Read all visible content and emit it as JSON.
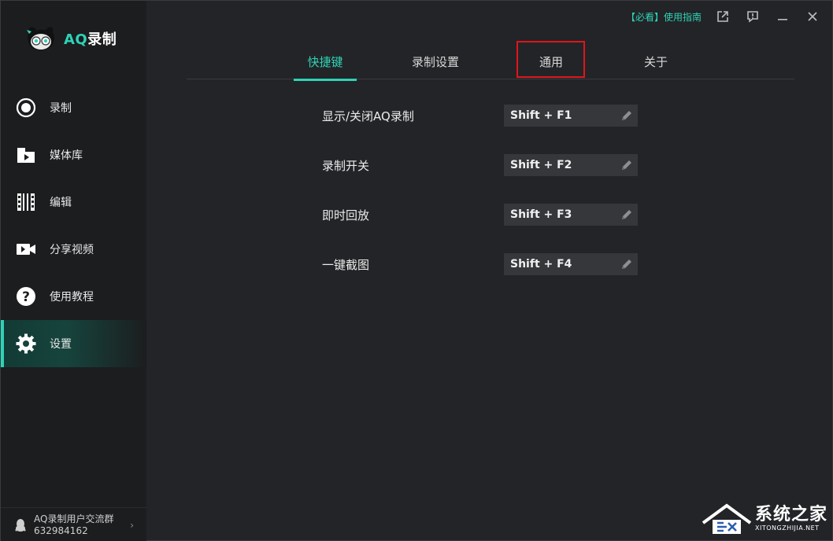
{
  "app": {
    "name_prefix": "AQ",
    "name_suffix": "录制"
  },
  "titlebar": {
    "guide_link": "【必看】使用指南",
    "icons": [
      "external-link-icon",
      "feedback-icon",
      "minimize-icon",
      "close-icon"
    ]
  },
  "sidebar": {
    "items": [
      {
        "label": "录制",
        "icon": "record-icon"
      },
      {
        "label": "媒体库",
        "icon": "media-library-icon"
      },
      {
        "label": "编辑",
        "icon": "edit-film-icon"
      },
      {
        "label": "分享视频",
        "icon": "share-video-icon"
      },
      {
        "label": "使用教程",
        "icon": "help-icon"
      },
      {
        "label": "设置",
        "icon": "gear-icon",
        "active": true
      }
    ],
    "community": {
      "line1": "AQ录制用户交流群",
      "line2": "632984162",
      "chevron": "›"
    }
  },
  "tabs": [
    {
      "label": "快捷键",
      "active": true
    },
    {
      "label": "录制设置"
    },
    {
      "label": "通用",
      "highlighted": true
    },
    {
      "label": "关于"
    }
  ],
  "shortcuts": [
    {
      "name": "显示/关闭AQ录制",
      "key": "Shift + F1"
    },
    {
      "name": "录制开关",
      "key": "Shift + F2"
    },
    {
      "name": "即时回放",
      "key": "Shift + F3"
    },
    {
      "name": "一键截图",
      "key": "Shift + F4"
    }
  ],
  "watermark": {
    "title": "系统之家",
    "subtitle": "XITONGZHIJIA.NET"
  },
  "colors": {
    "accent": "#2ed3b7",
    "highlight_box": "#e0151b",
    "background": "#232427",
    "sidebar": "#1c1d1f"
  }
}
